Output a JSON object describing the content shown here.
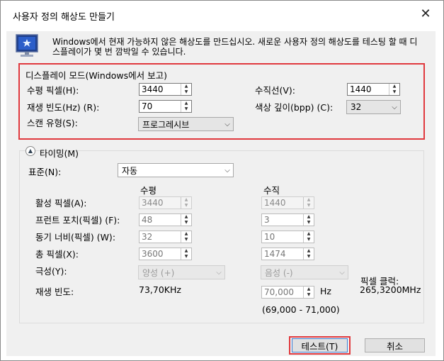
{
  "window": {
    "title": "사용자 정의 해상도 만들기",
    "close_glyph": "✕"
  },
  "description": "Windows에서 현재 가능하지 않은 해상도를 만드십시오. 새로운 사용자 정의 해상도를 테스팅 할 때 디스플레이가 몇 번 깜박일 수 있습니다.",
  "display_mode": {
    "title": "디스플레이 모드(Windows에서 보고)",
    "horizontal_pixels": {
      "label": "수평 픽셀(H):",
      "value": "3440"
    },
    "vertical_lines": {
      "label": "수직선(V):",
      "value": "1440"
    },
    "refresh_rate": {
      "label": "재생 빈도(Hz) (R):",
      "value": "70"
    },
    "color_depth": {
      "label": "색상 깊이(bpp) (C):",
      "value": "32"
    },
    "scan_type": {
      "label": "스캔 유형(S):",
      "value": "프로그레시브"
    }
  },
  "timing": {
    "title": "타이밍(M)",
    "standard": {
      "label": "표준(N):",
      "value": "자동"
    },
    "col_horizontal": "수평",
    "col_vertical": "수직",
    "rows": [
      {
        "label": "활성 픽셀(A):",
        "h": "3440",
        "v": "1440"
      },
      {
        "label": "프런트 포치(픽셀) (F):",
        "h": "48",
        "v": "3"
      },
      {
        "label": "동기 너비(픽셀) (W):",
        "h": "32",
        "v": "10"
      },
      {
        "label": "총 픽셀(X):",
        "h": "3600",
        "v": "1474"
      }
    ],
    "polarity": {
      "label": "극성(Y):",
      "h": "양성 (+)",
      "v": "음성 (-)"
    },
    "refresh": {
      "label": "재생 빈도:",
      "h": "73,70KHz",
      "v": "70,000",
      "unit": "Hz",
      "range": "(69,000 - 71,000)"
    },
    "pixel_clock": {
      "label": "픽셀 클럭:",
      "value": "265,3200MHz"
    }
  },
  "buttons": {
    "test": "테스트(T)",
    "cancel": "취소"
  },
  "colors": {
    "highlight_border": "#e0393e",
    "window_bg": "#f0f0f0"
  }
}
